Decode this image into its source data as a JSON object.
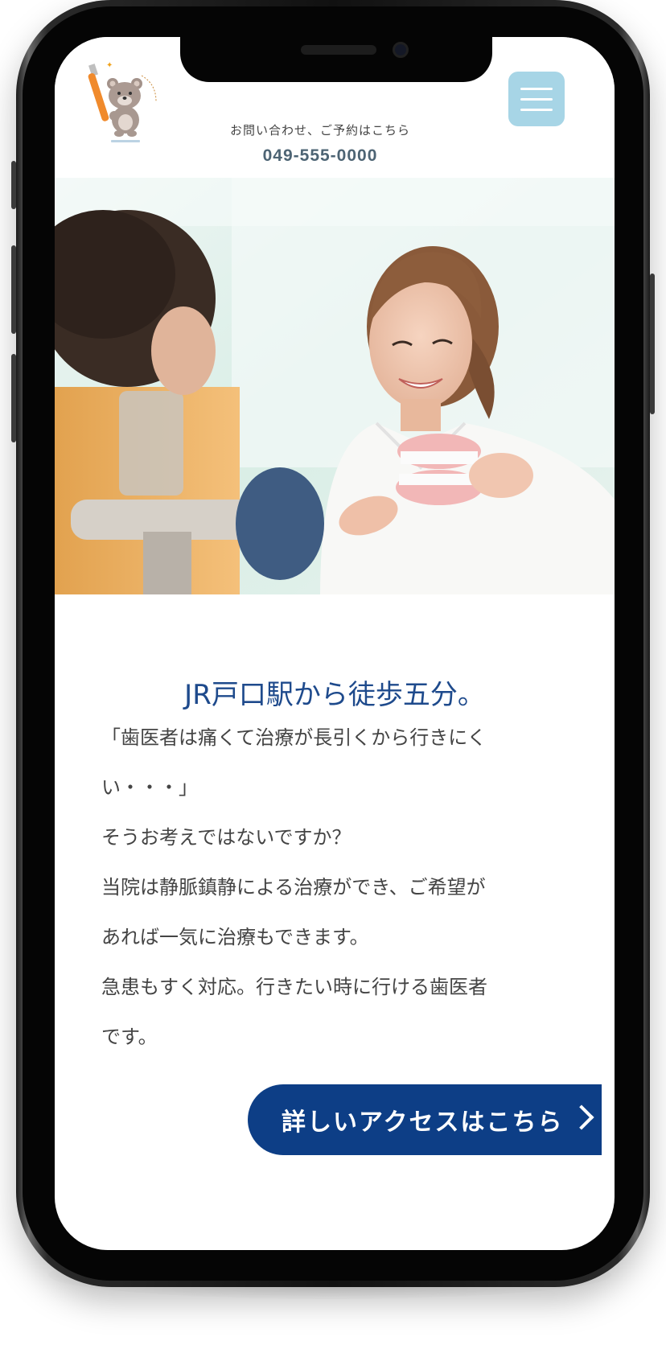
{
  "header": {
    "contact_label": "お問い合わせ、ご予約はこちら",
    "phone_number": "049-555-0000",
    "logo_icon": "clinic-bear-toothbrush-logo",
    "menu_icon": "hamburger-menu-icon"
  },
  "hero": {
    "image": "dentist-showing-denture-model-to-patient"
  },
  "main": {
    "headline": "JR戸口駅から徒歩五分。",
    "paragraphs": [
      "「歯医者は痛くて治療が長引くから行きにく",
      "い・・・」",
      "そうお考えではないですか？",
      "当院は静脈鎮静による治療ができ、ご希望が",
      "あれば一気に治療もできます。",
      "急患もすく対応。行きたい時に行ける歯医者",
      "です。"
    ]
  },
  "cta": {
    "label": "詳しいアクセスはこちら",
    "icon": "chevron-right-icon"
  },
  "colors": {
    "headline": "#1e4a8c",
    "cta_bg": "#0d3e86",
    "menu_bg": "#a7d5e6",
    "phone_number": "#4d6474"
  }
}
